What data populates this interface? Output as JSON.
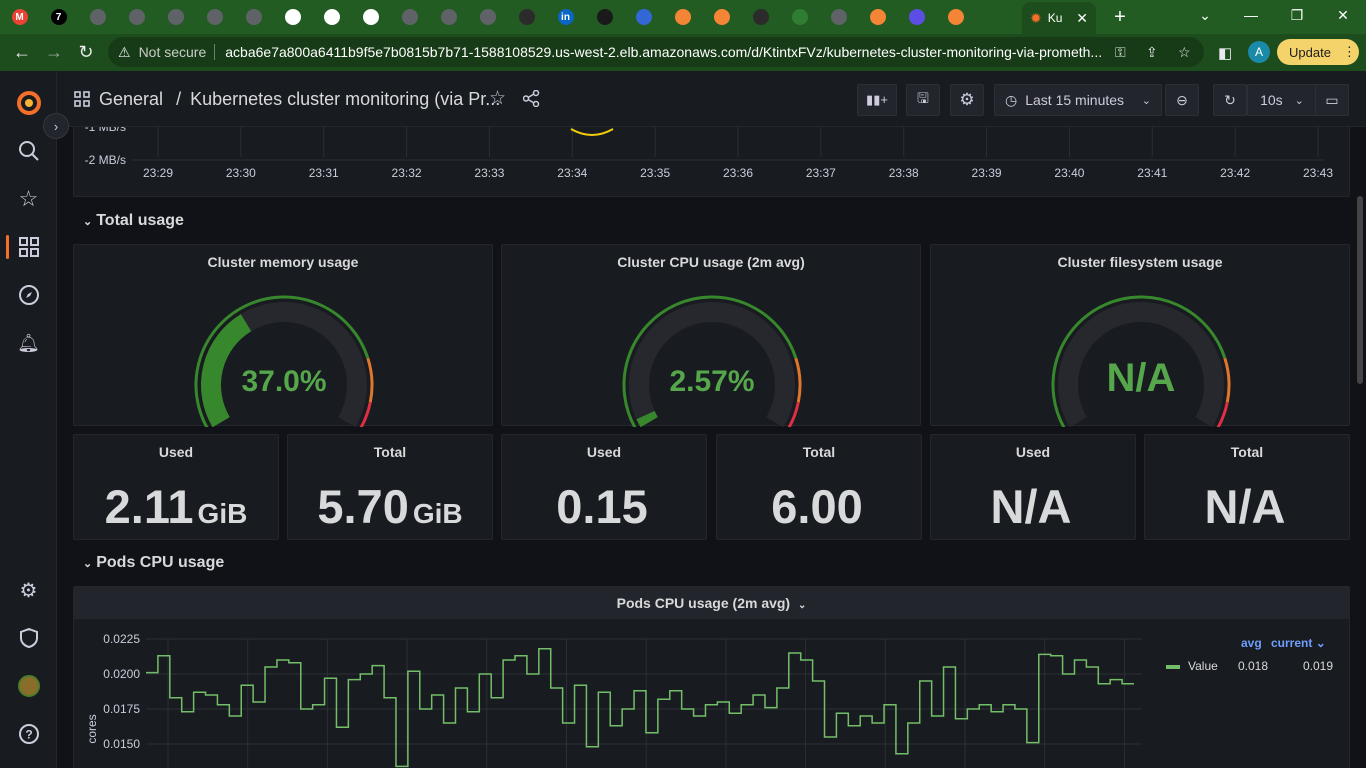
{
  "browser": {
    "tabs": [
      {
        "icon": "gmail-icon",
        "label": "M",
        "color": "#ea4335"
      },
      {
        "icon": "seven-icon",
        "label": "7",
        "color": "#000000"
      },
      {
        "icon": "globe-icon",
        "label": "",
        "color": "#5f6368"
      },
      {
        "icon": "globe-icon",
        "label": "",
        "color": "#5f6368"
      },
      {
        "icon": "globe-icon",
        "label": "",
        "color": "#5f6368"
      },
      {
        "icon": "globe-icon",
        "label": "",
        "color": "#5f6368"
      },
      {
        "icon": "globe-icon",
        "label": "",
        "color": "#5f6368"
      },
      {
        "icon": "globe-icon",
        "label": "",
        "color": "#ffffff"
      },
      {
        "icon": "globe-icon",
        "label": "",
        "color": "#ffffff"
      },
      {
        "icon": "globe-icon",
        "label": "",
        "color": "#ffffff"
      },
      {
        "icon": "globe-icon",
        "label": "",
        "color": "#5f6368"
      },
      {
        "icon": "globe-icon",
        "label": "",
        "color": "#5f6368"
      },
      {
        "icon": "globe-icon",
        "label": "",
        "color": "#5f6368"
      },
      {
        "icon": "hat-icon",
        "label": "",
        "color": "#2b2b2b"
      },
      {
        "icon": "linkedin-icon",
        "label": "in",
        "color": "#0a66c2"
      },
      {
        "icon": "cap-icon",
        "label": "",
        "color": "#1a1a1a"
      },
      {
        "icon": "cluster-icon",
        "label": "",
        "color": "#3367d6"
      },
      {
        "icon": "cube-icon",
        "label": "",
        "color": "#f58536"
      },
      {
        "icon": "cube-icon",
        "label": "",
        "color": "#f58536"
      },
      {
        "icon": "hat-icon",
        "label": "",
        "color": "#2b2b2b"
      },
      {
        "icon": "leaf-icon",
        "label": "",
        "color": "#2e7d32"
      },
      {
        "icon": "globe-icon",
        "label": "",
        "color": "#5f6368"
      },
      {
        "icon": "cube-icon",
        "label": "",
        "color": "#f58536"
      },
      {
        "icon": "terraform-icon",
        "label": "",
        "color": "#5c4ee5"
      },
      {
        "icon": "cube-icon",
        "label": "",
        "color": "#f58536"
      }
    ],
    "active_tab": "Ku",
    "url_warning": "Not secure",
    "url": "acba6e7a800a6411b9f5e7b0815b7b71-1588108529.us-west-2.elb.amazonaws.com/d/KtintxFVz/kubernetes-cluster-monitoring-via-prometh...",
    "profile_initial": "A",
    "update_label": "Update"
  },
  "grafana": {
    "breadcrumb_root": "General",
    "breadcrumb_sep": "/",
    "dashboard_title": "Kubernetes cluster monitoring (via Pr...",
    "time_range": "Last 15 minutes",
    "refresh_interval": "10s"
  },
  "top_graph": {
    "y_ticks": [
      "-1 MB/s",
      "-2 MB/s"
    ],
    "x_ticks": [
      "23:29",
      "23:30",
      "23:31",
      "23:32",
      "23:33",
      "23:34",
      "23:35",
      "23:36",
      "23:37",
      "23:38",
      "23:39",
      "23:40",
      "23:41",
      "23:42",
      "23:43"
    ]
  },
  "rows": {
    "total_usage": "Total usage",
    "pods_cpu": "Pods CPU usage"
  },
  "gauges": [
    {
      "title": "Cluster memory usage",
      "display": "37.0%",
      "value": 37.0,
      "color": "#37872d",
      "text_color": "#56a64b"
    },
    {
      "title": "Cluster CPU usage (2m avg)",
      "display": "2.57%",
      "value": 2.57,
      "color": "#37872d",
      "text_color": "#56a64b"
    },
    {
      "title": "Cluster filesystem usage",
      "display": "N/A",
      "value": null,
      "color": "#37872d",
      "text_color": "#56a64b"
    }
  ],
  "stats": [
    {
      "title": "Used",
      "value": "2.11",
      "unit": "GiB"
    },
    {
      "title": "Total",
      "value": "5.70",
      "unit": "GiB"
    },
    {
      "title": "Used",
      "value": "0.15",
      "unit": ""
    },
    {
      "title": "Total",
      "value": "6.00",
      "unit": ""
    },
    {
      "title": "Used",
      "value": "N/A",
      "unit": ""
    },
    {
      "title": "Total",
      "value": "N/A",
      "unit": ""
    }
  ],
  "pods_panel": {
    "title": "Pods CPU usage (2m avg)",
    "ylabel": "cores",
    "legend": {
      "col_avg": "avg",
      "col_current": "current",
      "series": "Value",
      "avg": "0.018",
      "current": "0.019"
    }
  },
  "chart_data": {
    "type": "line",
    "title": "Pods CPU usage (2m avg)",
    "ylabel": "cores",
    "y_ticks": [
      "0.0225",
      "0.0200",
      "0.0175",
      "0.0150"
    ],
    "ylim": [
      0.0135,
      0.0225
    ],
    "series": [
      {
        "name": "Value",
        "color": "#73bf69",
        "values": [
          0.0201,
          0.0213,
          0.0183,
          0.0173,
          0.0187,
          0.0185,
          0.0178,
          0.017,
          0.0192,
          0.018,
          0.0205,
          0.021,
          0.0208,
          0.0175,
          0.0178,
          0.0197,
          0.0162,
          0.0196,
          0.02,
          0.0206,
          0.0183,
          0.0134,
          0.0202,
          0.0175,
          0.0185,
          0.0165,
          0.019,
          0.0173,
          0.02,
          0.0183,
          0.021,
          0.0213,
          0.02,
          0.0218,
          0.019,
          0.0165,
          0.0192,
          0.0148,
          0.0187,
          0.0163,
          0.0175,
          0.0188,
          0.0158,
          0.0182,
          0.0188,
          0.0175,
          0.017,
          0.0178,
          0.018,
          0.0172,
          0.0178,
          0.0185,
          0.0176,
          0.019,
          0.0215,
          0.021,
          0.0195,
          0.0155,
          0.0172,
          0.0163,
          0.017,
          0.0165,
          0.0178,
          0.0143,
          0.0165,
          0.0195,
          0.017,
          0.0205,
          0.0168,
          0.0175,
          0.0178,
          0.0173,
          0.0178,
          0.0175,
          0.0151,
          0.0214,
          0.0213,
          0.02,
          0.021,
          0.0205,
          0.0193,
          0.0196,
          0.0193
        ]
      }
    ],
    "legend_position": "right"
  },
  "colors": {
    "accent": "#f36f2a",
    "background": "#111217",
    "panel": "#181b1f",
    "green": "#73bf69"
  }
}
